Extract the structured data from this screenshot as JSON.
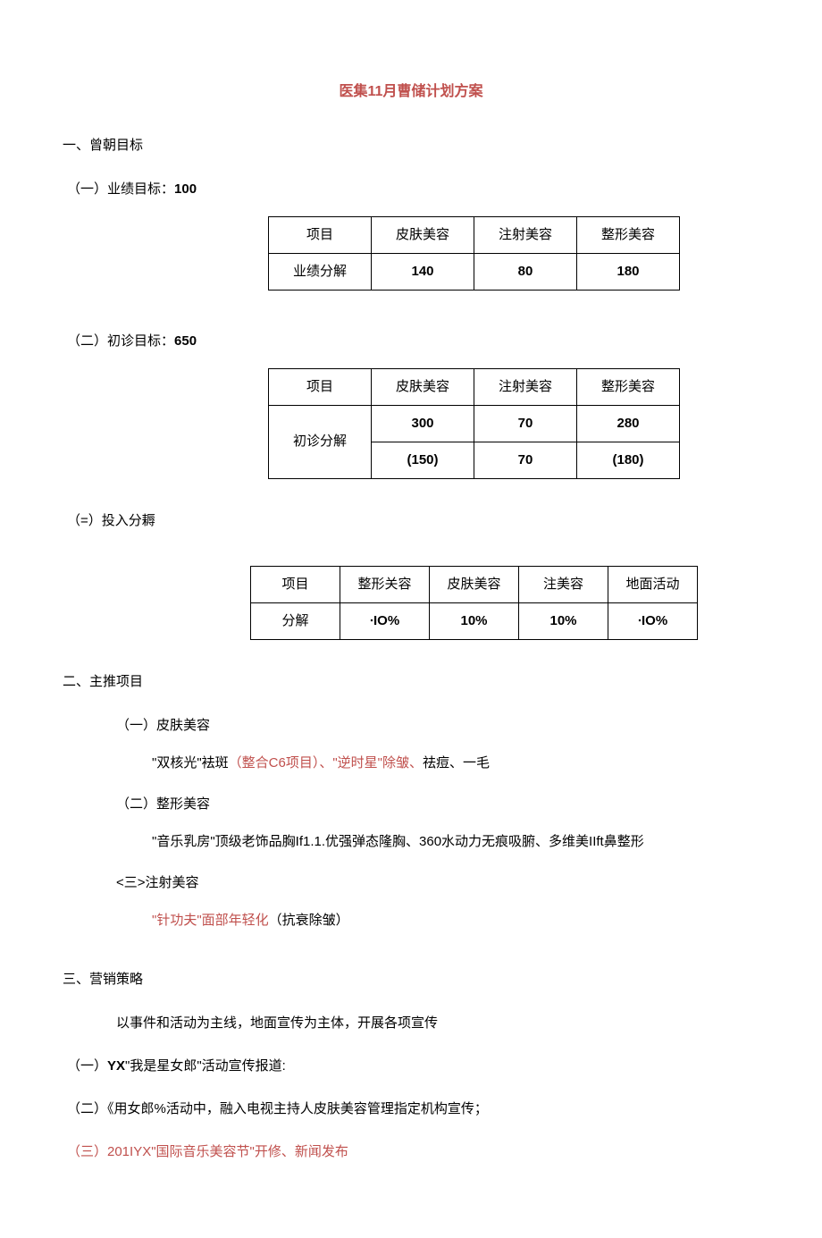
{
  "title": "医集11月曹储计划方案",
  "section1": {
    "heading": "一、曾朝目标",
    "sub1": {
      "label": "（一）业绩目标：",
      "value": "100",
      "table": {
        "headers": [
          "项目",
          "皮肤美容",
          "注射美容",
          "整形美容"
        ],
        "row_label": "业绩分解",
        "cells": [
          "140",
          "80",
          "180"
        ]
      }
    },
    "sub2": {
      "label": "（二）初诊目标：",
      "value": "650",
      "table": {
        "headers": [
          "项目",
          "皮肤美容",
          "注射美容",
          "整形美容"
        ],
        "row_label": "初诊分解",
        "cells": [
          "300",
          "70",
          "280"
        ],
        "cells2": [
          "(150)",
          "70",
          "(180)"
        ]
      }
    },
    "sub3": {
      "label": "（=）投入分耨",
      "table": {
        "headers": [
          "项目",
          "整形关容",
          "皮肤美容",
          "注美容",
          "地面活动"
        ],
        "row_label": "分解",
        "cells": [
          "∙IO%",
          "10%",
          "10%",
          "∙IO%"
        ]
      }
    }
  },
  "section2": {
    "heading": "二、主推项目",
    "sub1": {
      "label": "（一）皮肤美容",
      "line_pre": "\"双核光\"袪斑",
      "line_red": "（整合C6项目）、\"逆时星\"除皱、",
      "line_post": "祛痘、一毛"
    },
    "sub2": {
      "label": "（二）整形美容",
      "line": "\"音乐乳房\"顶级老饰品胸If1.1.优强弹态隆胸、360水动力无痕吸腑、多维美IIft鼻整形"
    },
    "sub3": {
      "label": "<三>注射美容",
      "line_red": "\"针功夫\"面部年轻化",
      "line_post": "（抗衰除皱）"
    }
  },
  "section3": {
    "heading": "三、营销策略",
    "intro": "以事件和活动为主线，地面宣传为主体，开展各项宣传",
    "item1_pre": "（一）",
    "item1_bold": "YX",
    "item1_post": "\"我是星女郎\"活动宣传报道:",
    "item2": "（二）《用女郎%活动中，融入电视主持人皮肤美容管理指定机构宣传；",
    "item3": "（三）201IYX\"国际音乐美容节\"开修、新闻发布"
  }
}
